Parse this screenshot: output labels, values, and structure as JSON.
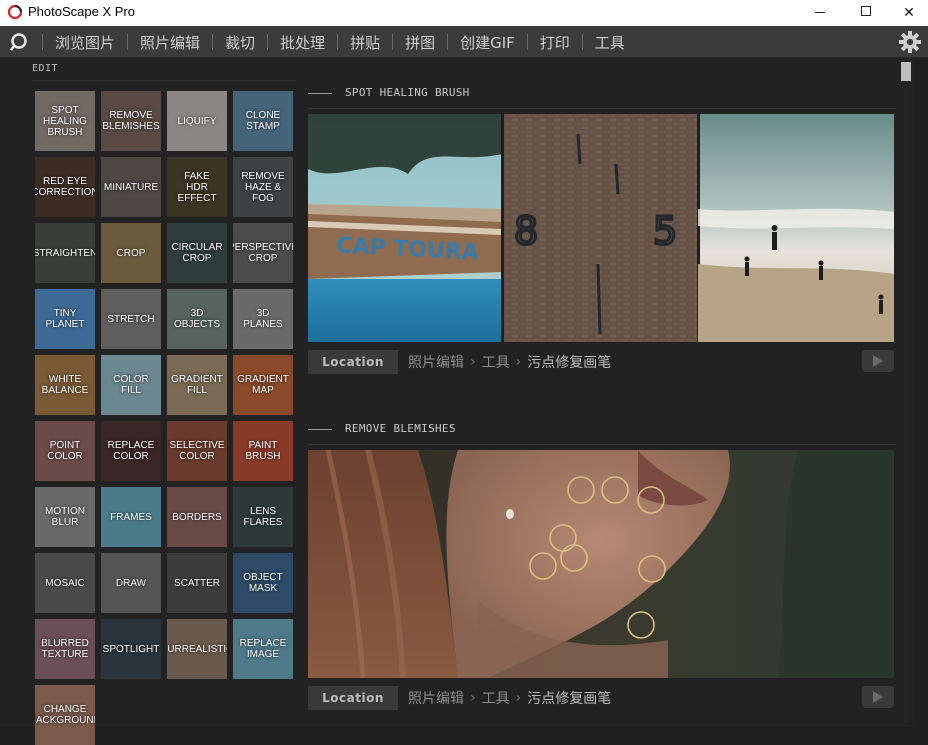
{
  "window": {
    "title": "PhotoScape X Pro",
    "controls": {
      "minimize": "minimize",
      "maximize": "maximize",
      "close": "✕"
    }
  },
  "menu": {
    "items": [
      "浏览图片",
      "照片编辑",
      "裁切",
      "批处理",
      "拼贴",
      "拼图",
      "创建GIF",
      "打印",
      "工具"
    ]
  },
  "edit_panel": {
    "label": "EDIT",
    "tools": [
      {
        "label": "SPOT HEALING BRUSH",
        "lines": [
          "SPOT",
          "HEALING",
          "BRUSH"
        ],
        "bg": "#6f6a62"
      },
      {
        "label": "REMOVE BLEMISHES",
        "lines": [
          "REMOVE",
          "BLEMISHES"
        ],
        "bg": "#5b4a43"
      },
      {
        "label": "LIQUIFY",
        "lines": [
          "LIQUIFY"
        ],
        "bg": "#8a8786"
      },
      {
        "label": "CLONE STAMP",
        "lines": [
          "CLONE",
          "STAMP"
        ],
        "bg": "#45647a"
      },
      {
        "label": "RED EYE CORRECTION",
        "lines": [
          "RED EYE",
          "CORRECTION"
        ],
        "small": true,
        "bg": "#3c2e25"
      },
      {
        "label": "MINIATURE",
        "lines": [
          "MINIATURE"
        ],
        "bg": "#4d4741"
      },
      {
        "label": "FAKE HDR EFFECT",
        "lines": [
          "FAKE",
          "HDR EFFECT"
        ],
        "bg": "#3a3624"
      },
      {
        "label": "REMOVE HAZE & FOG",
        "lines": [
          "REMOVE",
          "HAZE & FOG"
        ],
        "bg": "#3d4242"
      },
      {
        "label": "STRAIGHTEN",
        "lines": [
          "STRAIGHTEN"
        ],
        "small": true,
        "bg": "#393e38"
      },
      {
        "label": "CROP",
        "lines": [
          "CROP"
        ],
        "bg": "#6b5a3c"
      },
      {
        "label": "CIRCULAR CROP",
        "lines": [
          "CIRCULAR",
          "CROP"
        ],
        "bg": "#2f3d3a"
      },
      {
        "label": "PERSPECTIVE CROP",
        "lines": [
          "PERSPECTIVE",
          "CROP"
        ],
        "small": true,
        "bg": "#4c4c4c"
      },
      {
        "label": "TINY PLANET",
        "lines": [
          "TINY",
          "PLANET"
        ],
        "bg": "#3d6a95"
      },
      {
        "label": "STRETCH",
        "lines": [
          "STRETCH"
        ],
        "bg": "#5e5e5e"
      },
      {
        "label": "3D OBJECTS",
        "lines": [
          "3D",
          "OBJECTS"
        ],
        "bg": "#56635e"
      },
      {
        "label": "3D PLANES",
        "lines": [
          "3D",
          "PLANES"
        ],
        "bg": "#6a6a6a"
      },
      {
        "label": "WHITE BALANCE",
        "lines": [
          "WHITE",
          "BALANCE"
        ],
        "bg": "#7a5a34"
      },
      {
        "label": "COLOR FILL",
        "lines": [
          "COLOR",
          "FILL"
        ],
        "bg": "#6b8790"
      },
      {
        "label": "GRADIENT FILL",
        "lines": [
          "GRADIENT",
          "FILL"
        ],
        "bg": "#7a6a55"
      },
      {
        "label": "GRADIENT MAP",
        "lines": [
          "GRADIENT",
          "MAP"
        ],
        "bg": "#8a4a2a"
      },
      {
        "label": "POINT COLOR",
        "lines": [
          "POINT",
          "COLOR"
        ],
        "bg": "#6b4a4a"
      },
      {
        "label": "REPLACE COLOR",
        "lines": [
          "REPLACE",
          "COLOR"
        ],
        "bg": "#3b2626"
      },
      {
        "label": "SELECTIVE COLOR",
        "lines": [
          "SELECTIVE",
          "COLOR"
        ],
        "bg": "#6a3a2c"
      },
      {
        "label": "PAINT BRUSH",
        "lines": [
          "PAINT",
          "BRUSH"
        ],
        "bg": "#8a3a28"
      },
      {
        "label": "MOTION BLUR",
        "lines": [
          "MOTION",
          "BLUR"
        ],
        "bg": "#6a6a6a"
      },
      {
        "label": "FRAMES",
        "lines": [
          "FRAMES"
        ],
        "bg": "#4b7b8a"
      },
      {
        "label": "BORDERS",
        "lines": [
          "BORDERS"
        ],
        "bg": "#6a4a46"
      },
      {
        "label": "LENS FLARES",
        "lines": [
          "LENS",
          "FLARES"
        ],
        "bg": "#2e3a3a"
      },
      {
        "label": "MOSAIC",
        "lines": [
          "MOSAIC"
        ],
        "bg": "#4a4a4a"
      },
      {
        "label": "DRAW",
        "lines": [
          "DRAW"
        ],
        "bg": "#555555"
      },
      {
        "label": "SCATTER",
        "lines": [
          "SCATTER"
        ],
        "bg": "#3c3c3c"
      },
      {
        "label": "OBJECT MASK",
        "lines": [
          "OBJECT",
          "MASK"
        ],
        "bg": "#2e4a66"
      },
      {
        "label": "BLURRED TEXTURE",
        "lines": [
          "BLURRED",
          "TEXTURE"
        ],
        "bg": "#6a4e58"
      },
      {
        "label": "SPOTLIGHT",
        "lines": [
          "SPOTLIGHT"
        ],
        "bg": "#2a343c"
      },
      {
        "label": "SURREALISTIC",
        "lines": [
          "SURREALISTIC"
        ],
        "small": true,
        "bg": "#6a5a4e"
      },
      {
        "label": "REPLACE IMAGE",
        "lines": [
          "REPLACE",
          "IMAGE"
        ],
        "bg": "#4f7a8a"
      },
      {
        "label": "CHANGE BACKGROUND",
        "lines": [
          "CHANGE",
          "BACKGROUND"
        ],
        "small": true,
        "bg": "#7a5a4a"
      }
    ]
  },
  "sections": [
    {
      "title": "SPOT HEALING BRUSH",
      "location_button": "Location",
      "breadcrumb": [
        "照片编辑",
        "工具",
        "污点修复画笔"
      ]
    },
    {
      "title": "REMOVE BLEMISHES",
      "location_button": "Location",
      "breadcrumb": [
        "照片编辑",
        "工具",
        "污点修复画笔"
      ]
    }
  ],
  "boat_text": "CAP TOURA",
  "wall_numbers": [
    "8",
    "5"
  ],
  "colors": {
    "menu_bg": "#3b3b3b",
    "panel_bg": "#222222",
    "location_button_bg": "#3a3a3a",
    "blemish_ring": "#d8c080"
  }
}
